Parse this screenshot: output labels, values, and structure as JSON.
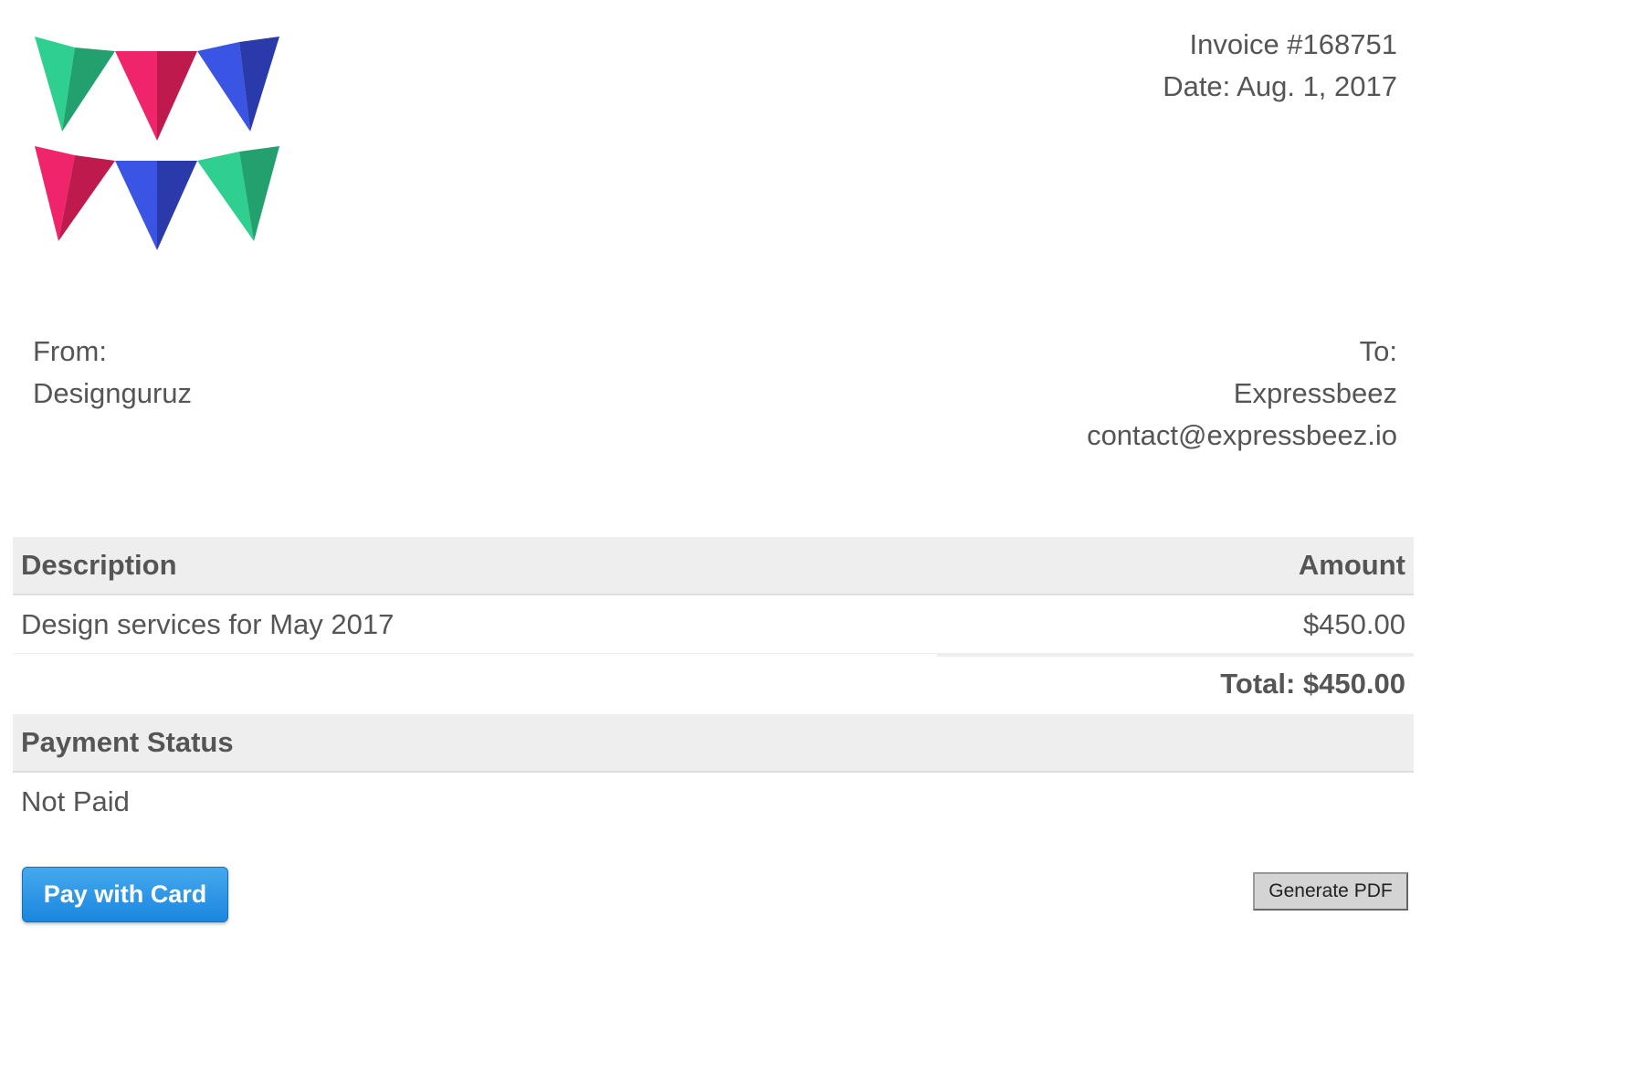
{
  "invoice": {
    "number_label": "Invoice #168751",
    "date_label": "Date: Aug. 1, 2017"
  },
  "from": {
    "label": "From:",
    "name": "Designguruz"
  },
  "to": {
    "label": "To:",
    "name": "Expressbeez",
    "email": "contact@expressbeez.io"
  },
  "items_table": {
    "headers": [
      "Description",
      "Amount"
    ],
    "rows": [
      {
        "description": "Design services for May 2017",
        "amount": "$450.00"
      }
    ],
    "total_label": "Total: $450.00"
  },
  "payment": {
    "heading": "Payment Status",
    "status": "Not Paid"
  },
  "buttons": {
    "pay_label": "Pay with Card",
    "pdf_label": "Generate PDF"
  },
  "logo": {
    "icon": "bunting-flags-logo",
    "colors": {
      "green": "#2ecf8f",
      "green_dark": "#22a06e",
      "pink": "#f0246a",
      "pink_dark": "#bf1a4d",
      "blue": "#3a55e4",
      "blue_dark": "#2a3aaa"
    }
  }
}
